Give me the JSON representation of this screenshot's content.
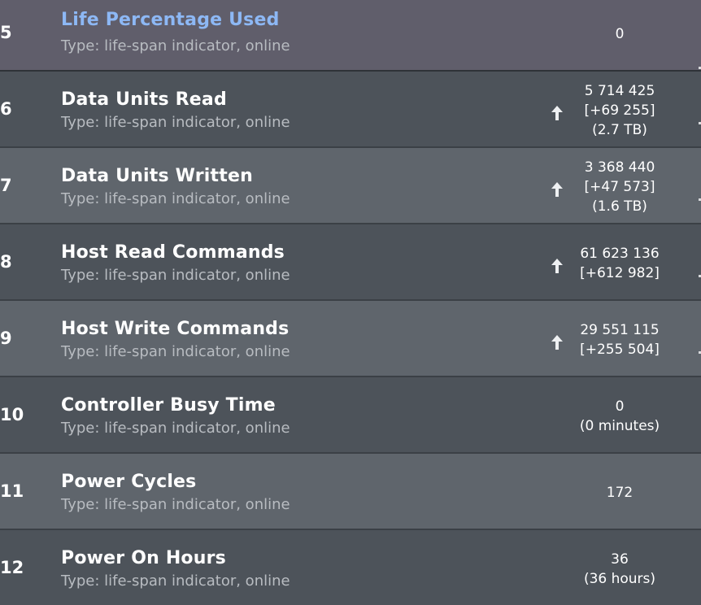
{
  "rows": [
    {
      "index": "5",
      "name": "Life Percentage Used",
      "type": "Type: life-span indicator, online",
      "value_lines": [
        "0"
      ],
      "trend": "none",
      "selected": true
    },
    {
      "index": "6",
      "name": "Data Units Read",
      "type": "Type: life-span indicator, online",
      "value_lines": [
        "5 714 425",
        "[+69 255]",
        "(2.7 TB)"
      ],
      "trend": "up-arrow-icon",
      "selected": false
    },
    {
      "index": "7",
      "name": "Data Units Written",
      "type": "Type: life-span indicator, online",
      "value_lines": [
        "3 368 440",
        "[+47 573]",
        "(1.6 TB)"
      ],
      "trend": "up-arrow-icon",
      "selected": false
    },
    {
      "index": "8",
      "name": "Host Read Commands",
      "type": "Type: life-span indicator, online",
      "value_lines": [
        "61 623 136",
        "[+612 982]"
      ],
      "trend": "up-arrow-icon",
      "selected": false
    },
    {
      "index": "9",
      "name": "Host Write Commands",
      "type": "Type: life-span indicator, online",
      "value_lines": [
        "29 551 115",
        "[+255 504]"
      ],
      "trend": "up-arrow-icon",
      "selected": false
    },
    {
      "index": "10",
      "name": "Controller Busy Time",
      "type": "Type: life-span indicator, online",
      "value_lines": [
        "0",
        "(0 minutes)"
      ],
      "trend": "none",
      "selected": false
    },
    {
      "index": "11",
      "name": "Power Cycles",
      "type": "Type: life-span indicator, online",
      "value_lines": [
        "172"
      ],
      "trend": "none",
      "selected": false
    },
    {
      "index": "12",
      "name": "Power On Hours",
      "type": "Type: life-span indicator, online",
      "value_lines": [
        "36",
        "(36 hours)"
      ],
      "trend": "none",
      "selected": false
    }
  ],
  "colors": {
    "selected_row_bg": "#605e6b",
    "selected_name": "#8db8f5",
    "row_dark": "#4d535a",
    "row_light": "#5f656c",
    "type_text": "#b8bcc1"
  }
}
